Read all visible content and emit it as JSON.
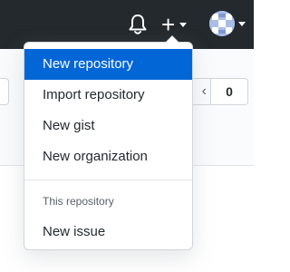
{
  "header": {
    "bell_icon": "bell-icon",
    "create_icon": "plus-icon",
    "avatar_icon": "identicon-avatar"
  },
  "page": {
    "counter_value": "0"
  },
  "dropdown": {
    "items": [
      {
        "label": "New repository",
        "active": true
      },
      {
        "label": "Import repository"
      },
      {
        "label": "New gist"
      },
      {
        "label": "New organization"
      }
    ],
    "section_header": "This repository",
    "section_items": [
      {
        "label": "New issue"
      }
    ]
  },
  "colors": {
    "topbar": "#24292e",
    "accent": "#0366d6",
    "menu_text": "#24292e",
    "muted_text": "#586069"
  }
}
